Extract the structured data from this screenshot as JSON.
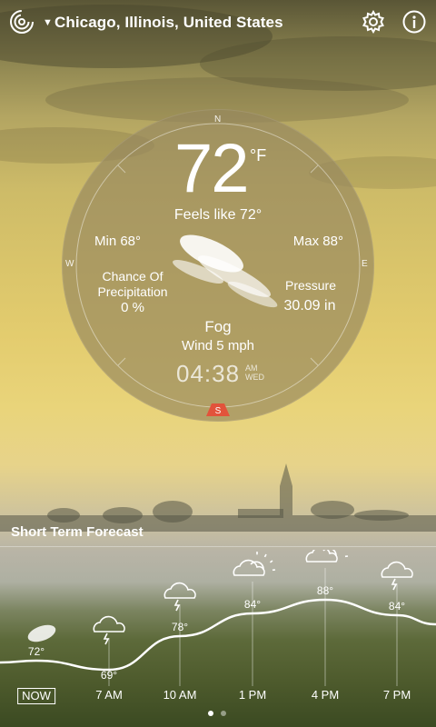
{
  "header": {
    "location": "Chicago, Illinois, United States",
    "icons": [
      "app-logo-icon",
      "dropdown-arrow-icon",
      "gear-icon",
      "info-icon"
    ]
  },
  "dial": {
    "compass": {
      "n": "N",
      "w": "W",
      "e": "E",
      "s": "S"
    },
    "temperature": "72",
    "unit": "°F",
    "feels_like": "Feels like 72°",
    "min": "Min 68°",
    "max": "Max 88°",
    "precipitation_label": "Chance Of Precipitation",
    "precipitation_value": "0 %",
    "pressure_label": "Pressure",
    "pressure_value": "30.09 in",
    "condition": "Fog",
    "wind": "Wind 5 mph",
    "time": "04:38",
    "am_pm": "AM",
    "day": "WED",
    "accent_color": "#e2533b"
  },
  "forecast": {
    "title": "Short Term Forecast",
    "times": [
      "NOW",
      "7 AM",
      "10 AM",
      "1 PM",
      "4 PM",
      "7 PM"
    ],
    "temps": [
      {
        "label": "72°",
        "icon": "fog-icon"
      },
      {
        "label": "69°",
        "icon": "cloud-rain-icon"
      },
      {
        "label": "78°",
        "icon": "cloud-rain-icon"
      },
      {
        "label": "84°",
        "icon": "partly-sunny-icon"
      },
      {
        "label": "88°",
        "icon": "partly-sunny-icon"
      },
      {
        "label": "84°",
        "icon": "cloud-rain-icon"
      }
    ],
    "page_indicator": {
      "pages": 2,
      "current": 1
    }
  }
}
